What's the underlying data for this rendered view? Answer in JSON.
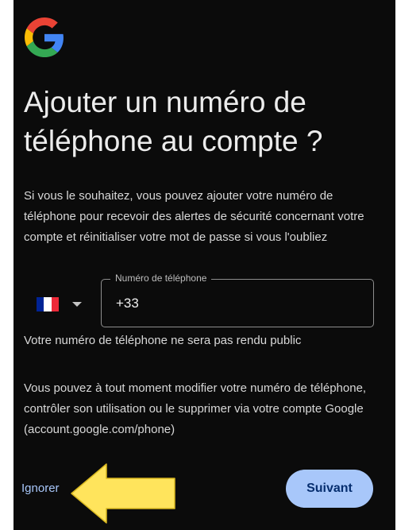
{
  "logo": {
    "icon": "google-g-icon",
    "colors": {
      "blue": "#4285F4",
      "red": "#EA4335",
      "yellow": "#FBBC05",
      "green": "#34A853"
    }
  },
  "page": {
    "title": "Ajouter un numéro de téléphone au compte ?",
    "description": "Si vous le souhaitez, vous pouvez ajouter votre numéro de téléphone pour recevoir des alertes de sécurité concernant votre compte et réinitialiser votre mot de passe si vous l'oubliez"
  },
  "phone": {
    "country_flag": "france-flag-icon",
    "flag_colors": [
      "#002395",
      "#FFFFFF",
      "#ED2939"
    ],
    "dropdown_icon": "caret-down-icon",
    "field_label": "Numéro de téléphone",
    "value": "+33"
  },
  "privacy_note": "Votre numéro de téléphone ne sera pas rendu public",
  "manage_note": "Vous pouvez à tout moment modifier votre numéro de téléphone, contrôler son utilisation ou le supprimer via votre compte Google (account.google.com/phone)",
  "actions": {
    "skip_label": "Ignorer",
    "next_label": "Suivant"
  },
  "annotation": {
    "icon": "left-arrow-icon",
    "color": "#FFE45C"
  },
  "theme": {
    "background": "#0B0B0B",
    "accent": "#A8C7FA"
  }
}
